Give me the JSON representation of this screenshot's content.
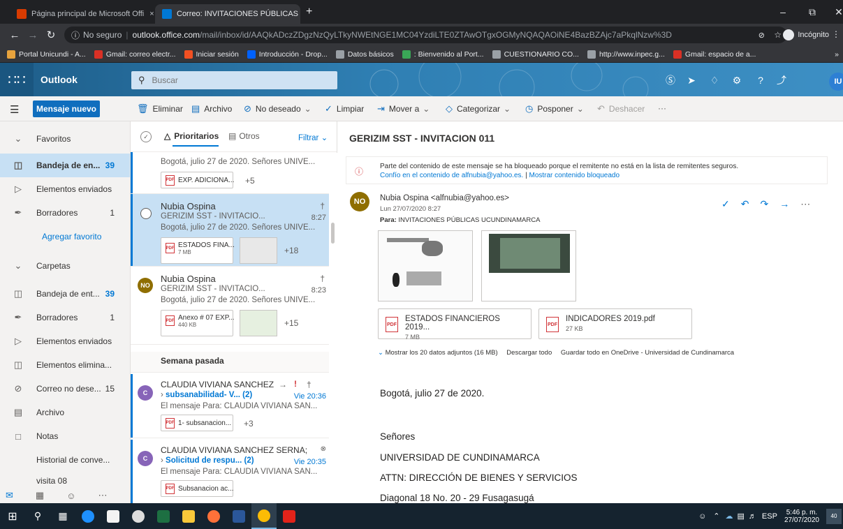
{
  "browser": {
    "tabs": [
      {
        "label": "Página principal de Microsoft Offi",
        "close": "×"
      },
      {
        "label": "Correo: INVITACIONES PÚBLICAS",
        "close": "×"
      }
    ],
    "new_tab": "+",
    "url_security": "No seguro",
    "url_host": "outlook.office.com",
    "url_path": "/mail/inbox/id/AAQkADczZDgzNzQyLTkyNWEtNGE1MC04YzdiLTE0ZTAwOTgxOGMyNQAQAOiNE4BazBZAjc7aPkqlNzw%3D",
    "incognito_label": "Incógnito",
    "bookmarks": [
      {
        "label": "Portal Unicundi - A...",
        "color": "#e8a33d"
      },
      {
        "label": "Gmail: correo electr...",
        "color": "#d93025"
      },
      {
        "label": "Iniciar sesión",
        "color": "#f25022"
      },
      {
        "label": "Introducción - Drop...",
        "color": "#0061fe"
      },
      {
        "label": "Datos básicos",
        "color": "#9aa0a6"
      },
      {
        "label": ": Bienvenido al Port...",
        "color": "#3aa757"
      },
      {
        "label": "CUESTIONARIO CO...",
        "color": "#9aa0a6"
      },
      {
        "label": "http://www.inpec.g...",
        "color": "#9aa0a6"
      },
      {
        "label": "Gmail: espacio de a...",
        "color": "#d93025"
      }
    ]
  },
  "outlook": {
    "brand": "Outlook",
    "search_placeholder": "Buscar",
    "avatar_initials": "IU",
    "new_message": "Mensaje nuevo",
    "commands": [
      "Eliminar",
      "Archivo",
      "No deseado",
      "Limpiar",
      "Mover a",
      "Categorizar",
      "Posponer",
      "Deshacer",
      "···"
    ]
  },
  "nav": {
    "favorites_label": "Favoritos",
    "favorites": [
      {
        "label": "Bandeja de en...",
        "count": "39"
      },
      {
        "label": "Elementos enviados",
        "count": ""
      },
      {
        "label": "Borradores",
        "count": "1"
      }
    ],
    "add_favorite": "Agregar favorito",
    "folders_label": "Carpetas",
    "folders": [
      {
        "label": "Bandeja de ent...",
        "count": "39"
      },
      {
        "label": "Borradores",
        "count": "1"
      },
      {
        "label": "Elementos enviados",
        "count": ""
      },
      {
        "label": "Elementos elimina...",
        "count": ""
      },
      {
        "label": "Correo no dese...",
        "count": "15"
      },
      {
        "label": "Archivo",
        "count": ""
      },
      {
        "label": "Notas",
        "count": ""
      },
      {
        "label": "Historial de conve...",
        "count": ""
      },
      {
        "label": "visita 08",
        "count": ""
      }
    ]
  },
  "list": {
    "tab_focused": "Prioritarios",
    "tab_other": "Otros",
    "filter": "Filtrar",
    "section_last_week": "Semana pasada",
    "items": [
      {
        "sender": "",
        "subject": "",
        "preview": "Bogotá, julio 27 de 2020. Señores UNIVE...",
        "time": "",
        "attach1": "EXP. ADICIONA...",
        "more": "+5"
      },
      {
        "sender": "Nubia Ospina",
        "subject": "GERIZIM SST - INVITACIO...",
        "preview": "Bogotá, julio 27 de 2020. Señores UNIVE...",
        "time": "8:27",
        "attach1": "ESTADOS FINA...",
        "attach1_size": "7 MB",
        "more": "+18"
      },
      {
        "sender": "Nubia Ospina",
        "initials": "NO",
        "subject": "GERIZIM SST - INVITACIO...",
        "preview": "Bogotá, julio 27 de 2020. Señores UNIVE...",
        "time": "8:23",
        "attach1": "Anexo # 07 EXP...",
        "attach1_size": "440 KB",
        "more": "+15"
      },
      {
        "sender": "CLAUDIA VIVIANA SANCHEZ",
        "initials": "C",
        "subject": "subsanabilidad- V...",
        "count": "(2)",
        "preview": "El mensaje Para: CLAUDIA VIVIANA SAN...",
        "time": "Vie 20:36",
        "attach1": "1- subsanacion...",
        "more": "+3"
      },
      {
        "sender": "CLAUDIA VIVIANA SANCHEZ SERNA;",
        "initials": "C",
        "subject": "Solicitud de respu...",
        "count": "(2)",
        "preview": "El mensaje Para: CLAUDIA VIVIANA SAN...",
        "time": "Vie 20:35",
        "attach1": "Subsanacion ac..."
      }
    ]
  },
  "reading": {
    "subject": "GERIZIM SST - INVITACION 011",
    "blocked_line1": "Parte del contenido de este mensaje se ha bloqueado porque el remitente no está en la lista de remitentes seguros.",
    "blocked_trust": "Confío en el contenido de alfnubia@yahoo.es.",
    "blocked_sep": "|",
    "blocked_show": "Mostrar contenido bloqueado",
    "from": "Nubia Ospina <alfnubia@yahoo.es>",
    "from_initials": "NO",
    "date": "Lun 27/07/2020 8:27",
    "to_label": "Para:",
    "to": "INVITACIONES PÚBLICAS UCUNDINAMARCA",
    "attachments": [
      {
        "name": "ESTADOS FINANCIEROS 2019...",
        "size": "7 MB"
      },
      {
        "name": "INDICADORES 2019.pdf",
        "size": "27 KB"
      }
    ],
    "show_all": "Mostrar los 20 datos adjuntos (16 MB)",
    "download_all": "Descargar todo",
    "save_onedrive": "Guardar todo en OneDrive - Universidad de Cundinamarca",
    "body": [
      "Bogotá, julio 27 de 2020.",
      "Señores",
      "UNIVERSIDAD DE CUNDINAMARCA",
      "ATTN: DIRECCIÓN DE BIENES Y SERVICIOS",
      "Diagonal 18 No. 20 - 29 Fusagasugá"
    ]
  },
  "taskbar": {
    "lang": "ESP",
    "time": "5:46 p. m.",
    "date": "27/07/2020",
    "notif": "40"
  }
}
